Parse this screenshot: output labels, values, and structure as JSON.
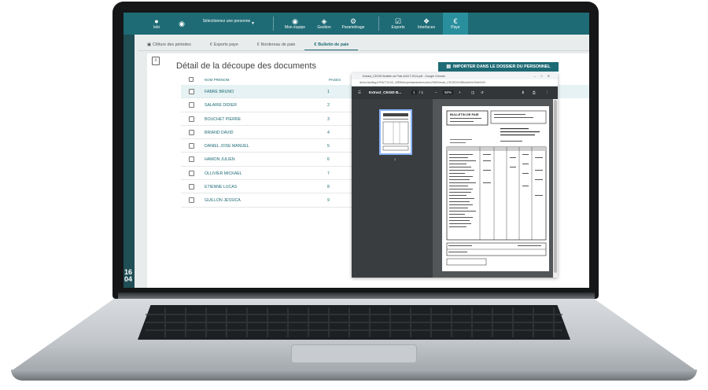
{
  "nav": {
    "user_label": "lebi",
    "selector_label": "Sélectionnez une personne",
    "items": [
      {
        "label": "Mon équipe",
        "icon": "team-icon"
      },
      {
        "label": "Gestion",
        "icon": "management-icon"
      },
      {
        "label": "Paramétrage",
        "icon": "gear-icon"
      },
      {
        "label": "Exports",
        "icon": "checkbox-icon"
      },
      {
        "label": "Interfaces",
        "icon": "puzzle-icon"
      },
      {
        "label": "Paye",
        "icon": "euro-icon"
      }
    ]
  },
  "tabs": [
    {
      "label": "Clôture des périodes",
      "icon": "calendar-icon"
    },
    {
      "label": "Exports paye",
      "icon": "euro-icon"
    },
    {
      "label": "Bordereau de paie",
      "icon": "euro-icon"
    },
    {
      "label": "Bulletin de paie",
      "icon": "euro-icon"
    }
  ],
  "rail": {
    "time_top": "16",
    "time_bottom": "04"
  },
  "panel": {
    "title": "Détail de la découpe des documents",
    "import_button": "IMPORTER DANS LE DOSSIER DU PERSONNEL"
  },
  "table": {
    "headers": {
      "name": "NOM PRENOM",
      "pages": "PAGES"
    },
    "rows": [
      {
        "name": "FABRE BRUNO",
        "page": "1"
      },
      {
        "name": "SALARIE DIDIER",
        "page": "2"
      },
      {
        "name": "BOUCHET PIERRE",
        "page": "3"
      },
      {
        "name": "BRIAND DAVID",
        "page": "4"
      },
      {
        "name": "DANIEL JOSE MANUEL",
        "page": "5"
      },
      {
        "name": "HAMON JULIEN",
        "page": "6"
      },
      {
        "name": "OLLIVIER MICKAEL",
        "page": "7"
      },
      {
        "name": "ETIENNE LUCAS",
        "page": "8"
      },
      {
        "name": "GUILLON JESSICA",
        "page": "9"
      }
    ]
  },
  "popup": {
    "window_title": "Extract_CEGID Bulletin de Paie AOUT 2014.pdf - Google Chrome",
    "url": "demo.factilog.fr/FACTILOG_WEB/temp/basededemo/doc235/Extract_CEGID%20Bulletin%20de%20",
    "pdf_title": "Extract_CEGID B...",
    "page_current": "1",
    "page_total": "/ 1",
    "zoom": "50%",
    "thumb_page": "1",
    "doc_heading": "BULLETIN DE PAIE"
  }
}
